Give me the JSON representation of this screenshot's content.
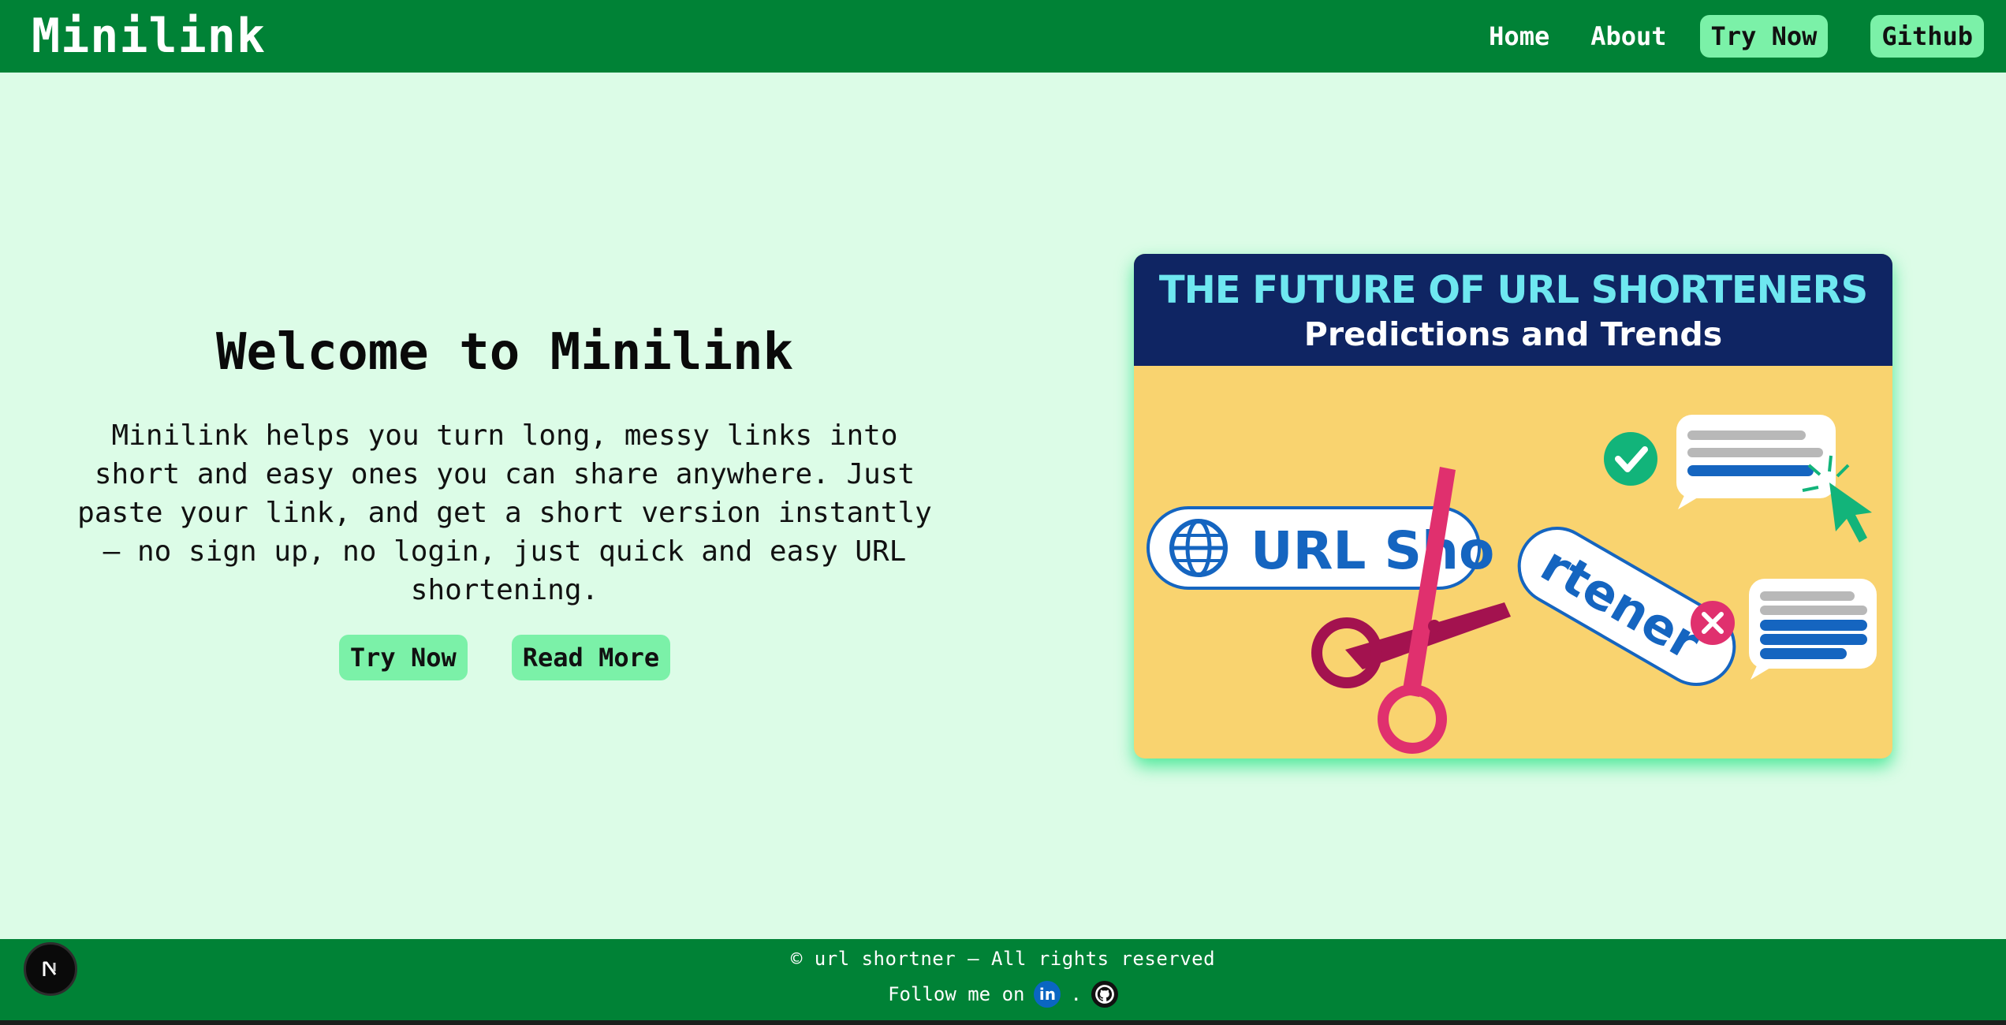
{
  "navbar": {
    "brand": "Minilink",
    "links": [
      "Home",
      "About"
    ],
    "try_now": "Try Now",
    "github": "Github"
  },
  "hero": {
    "title": "Welcome to Minilink",
    "description": "Minilink helps you turn long, messy links into short and easy ones you can share anywhere. Just paste your link, and get a short version instantly — no sign up, no login, just quick and easy URL shortening.",
    "try_now": "Try Now",
    "read_more": "Read More"
  },
  "banner": {
    "title": "THE FUTURE OF URL SHORTENERS",
    "subtitle": "Predictions and Trends",
    "url_bar_text": "URL Sho",
    "cut_piece_text": "rtener"
  },
  "footer": {
    "copyright": "© url shortner — All rights reserved",
    "follow_text": "Follow me on",
    "separator": ".",
    "linkedin_glyph": "in",
    "next_badge": "N"
  },
  "colors": {
    "page_bg": "#dcfce7",
    "nav_bg": "#008236",
    "button_bg": "#7bf1a8",
    "banner_head": "#0f2563",
    "banner_body": "#f9d36f"
  }
}
